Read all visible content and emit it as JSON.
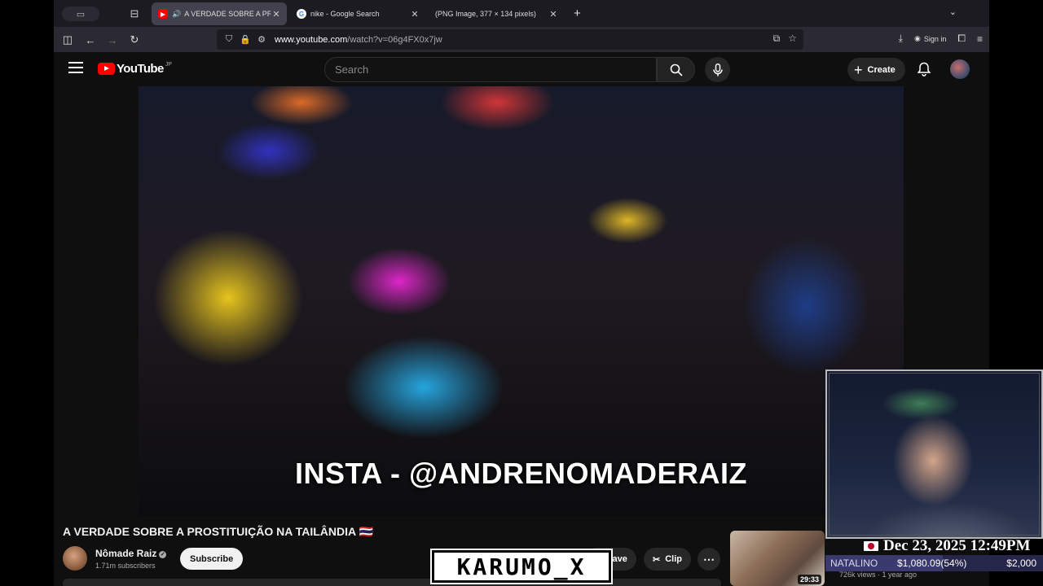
{
  "browser": {
    "tabs": [
      {
        "label": "A VERDADE SOBRE A PROSTITUIÇÃO",
        "active": true,
        "favicon": "youtube-icon",
        "audio": true
      },
      {
        "label": "nike - Google Search",
        "active": false,
        "favicon": "google-icon"
      },
      {
        "label": "(PNG Image, 377 × 134 pixels)",
        "active": false,
        "favicon": ""
      }
    ],
    "url_host": "www.youtube.com",
    "url_path": "/watch?v=06g4FX0x7jw",
    "sign_in": "Sign in"
  },
  "youtube": {
    "logo_text": "YouTube",
    "country_code": "JP",
    "search_placeholder": "Search",
    "create_label": "Create"
  },
  "video": {
    "overlay_text": "INSTA - @ANDRENOMADERAIZ",
    "title": "A VERDADE SOBRE A PROSTITUIÇÃO NA TAILÂNDIA 🇹🇭",
    "channel_name": "Nômade Raiz",
    "subscribers": "1.71m subscribers",
    "subscribe_label": "Subscribe",
    "save_label": "Save",
    "clip_label": "Clip"
  },
  "recommendation": {
    "duration": "29:33",
    "meta": "726k views · 1 year ago"
  },
  "stream_overlay": {
    "datetime": "Dec 23, 2025 12:49PM",
    "donor": "NATALINO",
    "amount": "$1,080.09",
    "percent": "(54%)",
    "progress": 0.54,
    "goal": "$2,000",
    "watermark": "KARUMO_X"
  }
}
